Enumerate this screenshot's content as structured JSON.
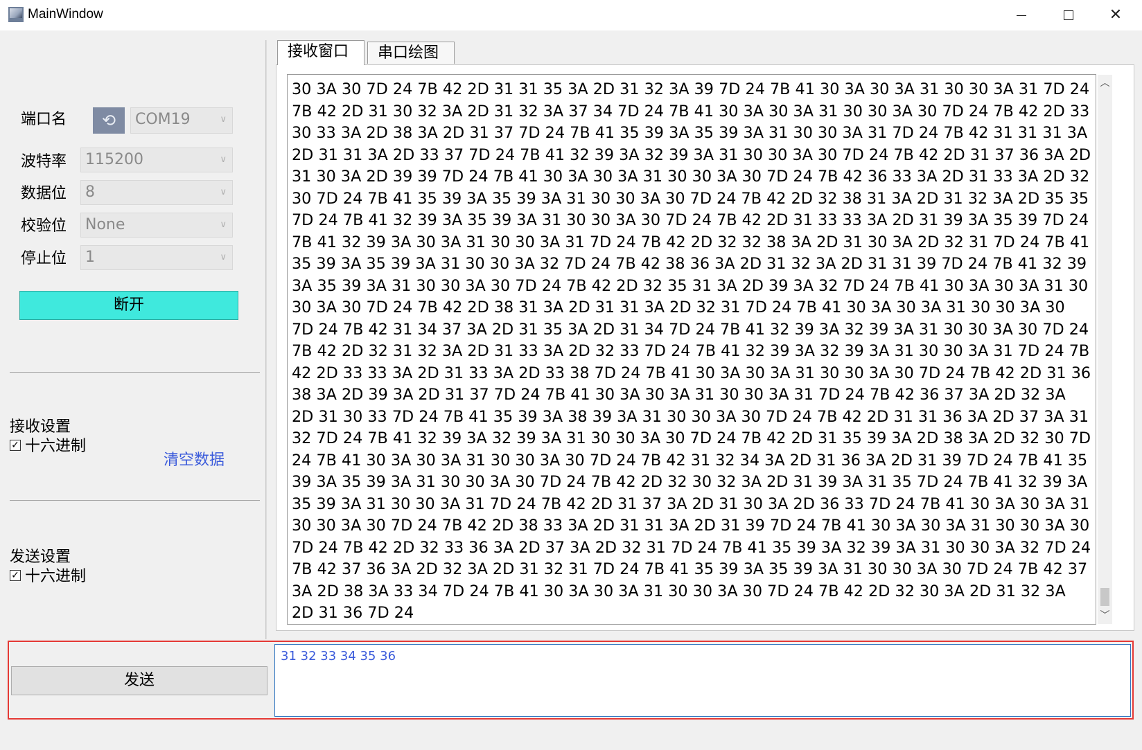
{
  "window": {
    "title": "MainWindow",
    "minimize": "—",
    "maximize": "☐",
    "close": "✕"
  },
  "serial": {
    "port": {
      "label": "端口名",
      "value": "COM19"
    },
    "baud": {
      "label": "波特率",
      "value": "115200"
    },
    "data_bits": {
      "label": "数据位",
      "value": "8"
    },
    "parity": {
      "label": "校验位",
      "value": "None"
    },
    "stop_bits": {
      "label": "停止位",
      "value": "1"
    },
    "disconnect_label": "断开"
  },
  "receive_settings": {
    "title": "接收设置",
    "hex_label": "十六进制",
    "hex_checked": true,
    "clear_label": "清空数据"
  },
  "send_settings": {
    "title": "发送设置",
    "hex_label": "十六进制",
    "hex_checked": true
  },
  "tabs": [
    {
      "label": "接收窗口",
      "active": true
    },
    {
      "label": "串口绘图",
      "active": false
    }
  ],
  "receive_text": "30 3A 30 7D 24 7B 42 2D 31 31 35 3A 2D 31 32 3A 39 7D 24 7B 41 30 3A 30 3A 31 30 30 3A 31 7D 24 7B 42 2D 31 30 32 3A 2D 31 32 3A 37 34 7D 24 7B 41 30 3A 30 3A 31 30 30 3A 30 7D 24 7B 42 2D 33 30 33 3A 2D 38 3A 2D 31 37 7D 24 7B 41 35 39 3A 35 39 3A 31 30 30 3A 31 7D 24 7B 42 31 31 31 3A 2D 31 31 3A 2D 33 37 7D 24 7B 41 32 39 3A 32 39 3A 31 30 30 3A 30 7D 24 7B 42 2D 31 37 36 3A 2D 31 30 3A 2D 39 39 7D 24 7B 41 30 3A 30 3A 31 30 30 3A 30 7D 24 7B 42 36 33 3A 2D 31 33 3A 2D 32 30 7D 24 7B 41 35 39 3A 35 39 3A 31 30 30 3A 30 7D 24 7B 42 2D 32 38 31 3A 2D 31 32 3A 2D 35 35 7D 24 7B 41 32 39 3A 35 39 3A 31 30 30 3A 30 7D 24 7B 42 2D 31 33 33 3A 2D 31 39 3A 35 39 7D 24 7B 41 32 39 3A 30 3A 31 30 30 3A 31 7D 24 7B 42 2D 32 32 38 3A 2D 31 30 3A 2D 32 31 7D 24 7B 41 35 39 3A 35 39 3A 31 30 30 3A 32 7D 24 7B 42 38 36 3A 2D 31 32 3A 2D 31 31 39 7D 24 7B 41 32 39 3A 35 39 3A 31 30 30 3A 30 7D 24 7B 42 2D 32 35 31 3A 2D 39 3A 32 7D 24 7B 41 30 3A 30 3A 31 30 30 3A 30 7D 24 7B 42 2D 38 31 3A 2D 31 31 3A 2D 32 31 7D 24 7B 41 30 3A 30 3A 31 30 30 3A 30 7D 24 7B 42 31 34 37 3A 2D 31 35 3A 2D 31 34 7D 24 7B 41 32 39 3A 32 39 3A 31 30 30 3A 30 7D 24 7B 42 2D 32 31 32 3A 2D 31 33 3A 2D 32 33 7D 24 7B 41 32 39 3A 32 39 3A 31 30 30 3A 31 7D 24 7B 42 2D 33 33 3A 2D 31 33 3A 2D 33 38 7D 24 7B 41 30 3A 30 3A 31 30 30 3A 30 7D 24 7B 42 2D 31 36 38 3A 2D 39 3A 2D 31 37 7D 24 7B 41 30 3A 30 3A 31 30 30 3A 31 7D 24 7B 42 36 37 3A 2D 32 3A 2D 31 30 33 7D 24 7B 41 35 39 3A 38 39 3A 31 30 30 3A 30 7D 24 7B 42 2D 31 31 36 3A 2D 37 3A 31 32 7D 24 7B 41 32 39 3A 32 39 3A 31 30 30 3A 30 7D 24 7B 42 2D 31 35 39 3A 2D 38 3A 2D 32 30 7D 24 7B 41 30 3A 30 3A 31 30 30 3A 30 7D 24 7B 42 31 32 34 3A 2D 31 36 3A 2D 31 39 7D 24 7B 41 35 39 3A 35 39 3A 31 30 30 3A 30 7D 24 7B 42 2D 32 30 32 3A 2D 31 39 3A 31 35 7D 24 7B 41 32 39 3A 35 39 3A 31 30 30 3A 31 7D 24 7B 42 2D 31 37 3A 2D 31 30 3A 2D 36 33 7D 24 7B 41 30 3A 30 3A 31 30 30 3A 30 7D 24 7B 42 2D 38 33 3A 2D 31 31 3A 2D 31 39 7D 24 7B 41 30 3A 30 3A 31 30 30 3A 30 7D 24 7B 42 2D 32 33 36 3A 2D 37 3A 2D 32 31 7D 24 7B 41 35 39 3A 32 39 3A 31 30 30 3A 32 7D 24 7B 42 37 36 3A 2D 32 3A 2D 31 32 31 7D 24 7B 41 35 39 3A 35 39 3A 31 30 30 3A 30 7D 24 7B 42 37 3A 2D 38 3A 33 34 7D 24 7B 41 30 3A 30 3A 31 30 30 3A 30 7D 24 7B 42 2D 32 30 3A 2D 31 32 3A 2D 31 36 7D 24",
  "send": {
    "button_label": "发送",
    "input_value": "31 32 33 34 35 36"
  }
}
